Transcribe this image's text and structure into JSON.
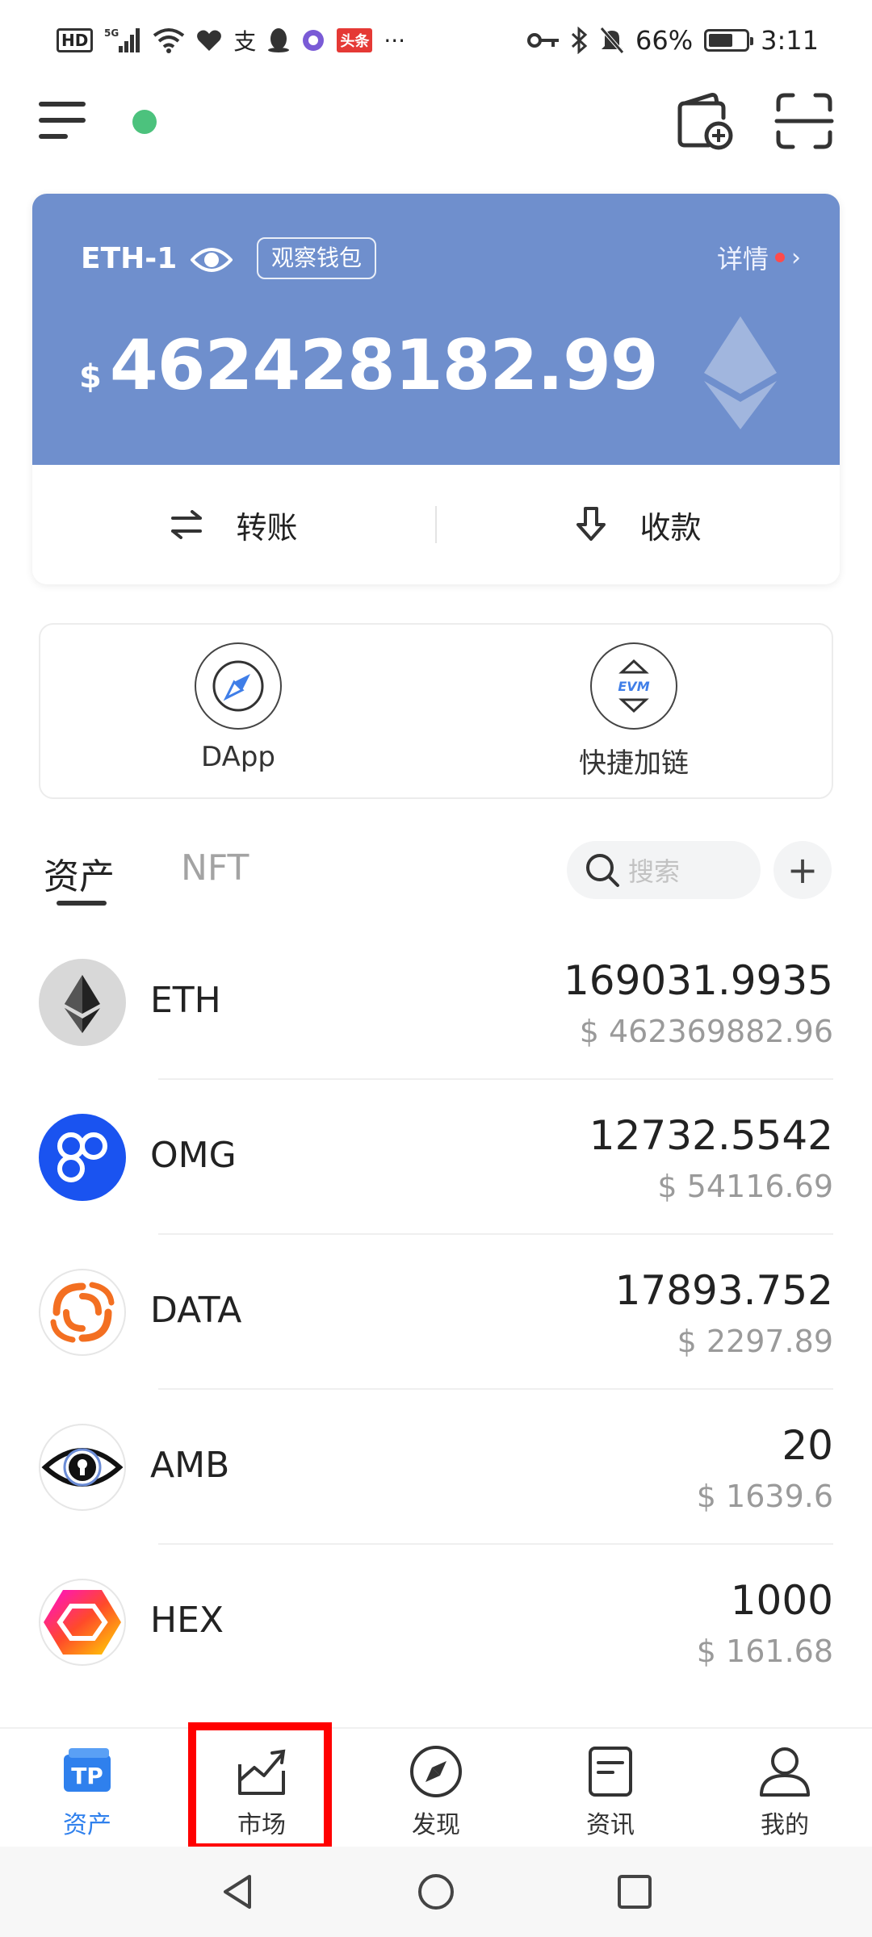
{
  "status_bar": {
    "hd": "HD",
    "signal": "5G",
    "alipay": "支",
    "toutiao": "头条",
    "more": "···",
    "battery": "66%",
    "battery_level": 0.66,
    "time": "3:11"
  },
  "wallet": {
    "name": "ETH-1",
    "tag": "观察钱包",
    "details_label": "详情",
    "currency_symbol": "$",
    "balance": "462428182.99",
    "transfer_label": "转账",
    "receive_label": "收款",
    "card_color": "#6f8fcd"
  },
  "quick": {
    "dapp_label": "DApp",
    "add_chain_label": "快捷加链",
    "evm_text": "EVM"
  },
  "tabs": {
    "assets": "资产",
    "nft": "NFT",
    "search_placeholder": "搜索",
    "plus": "+"
  },
  "tokens": [
    {
      "symbol": "ETH",
      "amount": "169031.9935",
      "value": "$ 462369882.96",
      "icon": "ethereum-icon"
    },
    {
      "symbol": "OMG",
      "amount": "12732.5542",
      "value": "$ 54116.69",
      "icon": "omg-icon"
    },
    {
      "symbol": "DATA",
      "amount": "17893.752",
      "value": "$ 2297.89",
      "icon": "streamr-data-icon"
    },
    {
      "symbol": "AMB",
      "amount": "20",
      "value": "$ 1639.6",
      "icon": "ambrosus-icon"
    },
    {
      "symbol": "HEX",
      "amount": "1000",
      "value": "$ 161.68",
      "icon": "hex-icon"
    }
  ],
  "bottom_nav": {
    "assets": "资产",
    "market": "市场",
    "discover": "发现",
    "news": "资讯",
    "mine": "我的",
    "tp_text": "TP",
    "active_color": "#2f80ed",
    "highlight_color": "#ff0000"
  }
}
